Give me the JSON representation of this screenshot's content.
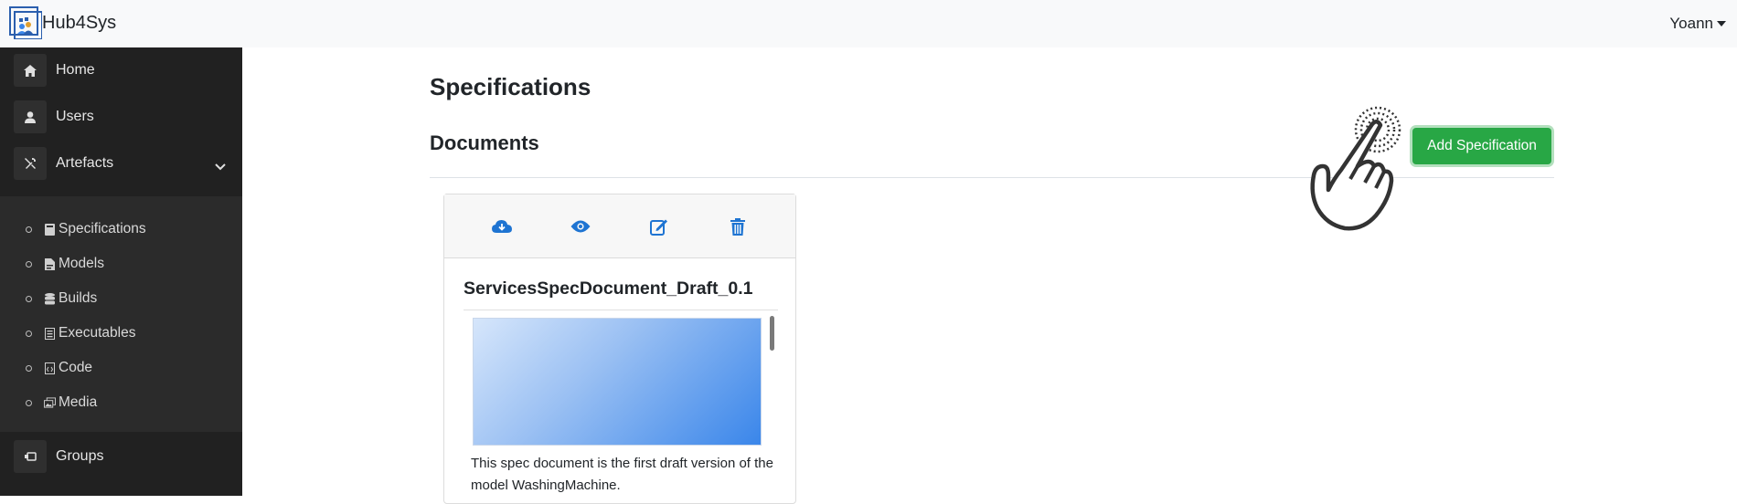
{
  "app": {
    "brand": "Hub4Sys",
    "user": "Yoann"
  },
  "sidebar": {
    "items": [
      {
        "label": "Home",
        "icon": "home-icon"
      },
      {
        "label": "Users",
        "icon": "user-icon"
      },
      {
        "label": "Artefacts",
        "icon": "tools-icon"
      },
      {
        "label": "Groups",
        "icon": "groups-icon"
      }
    ],
    "sub_items": [
      {
        "label": "Specifications",
        "icon": "book-icon"
      },
      {
        "label": "Models",
        "icon": "file-icon"
      },
      {
        "label": "Builds",
        "icon": "database-icon"
      },
      {
        "label": "Executables",
        "icon": "file-list-icon"
      },
      {
        "label": "Code",
        "icon": "code-file-icon"
      },
      {
        "label": "Media",
        "icon": "images-icon"
      }
    ]
  },
  "main": {
    "title": "Specifications",
    "section": "Documents",
    "add_button": "Add Specification"
  },
  "card": {
    "title": "ServicesSpecDocument_Draft_0.1",
    "description": "This spec document is the first draft version of the model WashingMachine.",
    "actions": [
      "download-icon",
      "view-icon",
      "edit-icon",
      "delete-icon"
    ]
  },
  "colors": {
    "sidebar_bg": "#212121",
    "accent_green": "#28a745",
    "action_blue": "#1e74d2"
  }
}
